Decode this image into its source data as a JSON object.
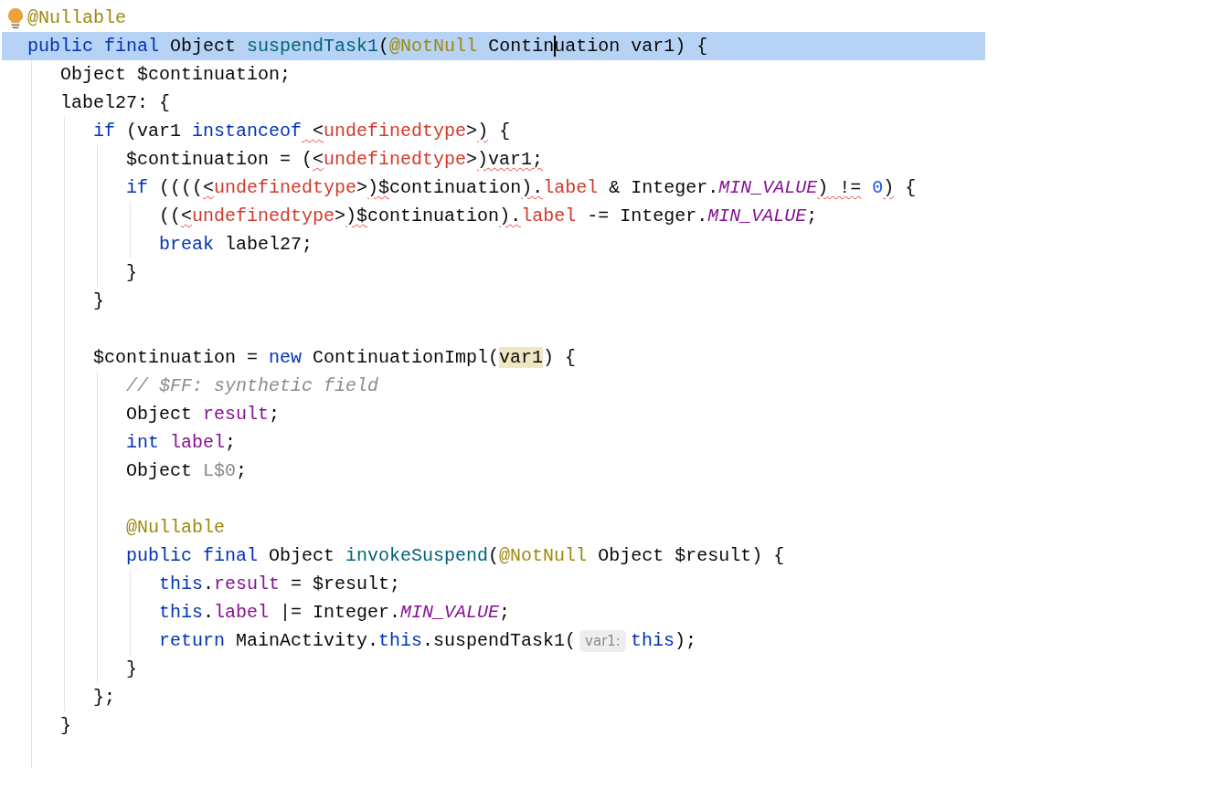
{
  "editor": {
    "lines": [
      {
        "current": false,
        "intention_bulb": true,
        "tokens": [
          {
            "kind": "annotation",
            "text": "@Nullable"
          }
        ]
      },
      {
        "current": true,
        "tokens": [
          {
            "kind": "keyword",
            "text": "public final "
          },
          {
            "kind": "plain",
            "text": "Object "
          },
          {
            "kind": "method",
            "text": "suspendTask1"
          },
          {
            "kind": "plain",
            "text": "("
          },
          {
            "kind": "annotation",
            "text": "@NotNull "
          },
          {
            "kind": "plain",
            "text": "Contin"
          },
          {
            "kind": "plain",
            "text": "uation var1) {",
            "caret": true
          }
        ],
        "children": [
          {
            "current": false,
            "tokens": [
              {
                "kind": "plain",
                "text": "Object $continuation;"
              }
            ]
          },
          {
            "current": false,
            "tokens": [
              {
                "kind": "plain",
                "text": "label27: {"
              }
            ],
            "children": [
              {
                "current": false,
                "tokens": [
                  {
                    "kind": "keyword",
                    "text": "if"
                  },
                  {
                    "kind": "plain",
                    "text": " (var1 "
                  },
                  {
                    "kind": "keyword",
                    "text": "instanceof"
                  },
                  {
                    "kind": "plain",
                    "text": " <",
                    "error": true
                  },
                  {
                    "kind": "unresolved",
                    "text": "undefinedtype"
                  },
                  {
                    "kind": "plain",
                    "text": ">"
                  },
                  {
                    "kind": "plain",
                    "text": ")",
                    "error": true
                  },
                  {
                    "kind": "plain",
                    "text": " {"
                  }
                ],
                "children": [
                  {
                    "current": false,
                    "tokens": [
                      {
                        "kind": "plain",
                        "text": "$continuation = ("
                      },
                      {
                        "kind": "plain",
                        "text": "<",
                        "error": true
                      },
                      {
                        "kind": "unresolved",
                        "text": "undefinedtype"
                      },
                      {
                        "kind": "plain",
                        "text": ">"
                      },
                      {
                        "kind": "plain",
                        "text": ")var1;",
                        "error": true
                      }
                    ]
                  },
                  {
                    "current": false,
                    "tokens": [
                      {
                        "kind": "keyword",
                        "text": "if"
                      },
                      {
                        "kind": "plain",
                        "text": " (((("
                      },
                      {
                        "kind": "plain",
                        "text": "<",
                        "error": true
                      },
                      {
                        "kind": "unresolved",
                        "text": "undefinedtype"
                      },
                      {
                        "kind": "plain",
                        "text": ">"
                      },
                      {
                        "kind": "plain",
                        "text": ")$",
                        "error": true
                      },
                      {
                        "kind": "plain",
                        "text": "continuation"
                      },
                      {
                        "kind": "plain",
                        "text": ").",
                        "error": true
                      },
                      {
                        "kind": "unresolved",
                        "text": "label"
                      },
                      {
                        "kind": "plain",
                        "text": " & Integer."
                      },
                      {
                        "kind": "constant",
                        "text": "MIN_VALUE"
                      },
                      {
                        "kind": "plain",
                        "text": ")",
                        "error": true
                      },
                      {
                        "kind": "plain",
                        "text": " !=",
                        "error": true
                      },
                      {
                        "kind": "number",
                        "text": " 0"
                      },
                      {
                        "kind": "plain",
                        "text": ")",
                        "error": true
                      },
                      {
                        "kind": "plain",
                        "text": " {"
                      }
                    ],
                    "children": [
                      {
                        "current": false,
                        "tokens": [
                          {
                            "kind": "plain",
                            "text": "(("
                          },
                          {
                            "kind": "plain",
                            "text": "<",
                            "error": true
                          },
                          {
                            "kind": "unresolved",
                            "text": "undefinedtype"
                          },
                          {
                            "kind": "plain",
                            "text": ">"
                          },
                          {
                            "kind": "plain",
                            "text": ")$",
                            "error": true
                          },
                          {
                            "kind": "plain",
                            "text": "continuation"
                          },
                          {
                            "kind": "plain",
                            "text": ").",
                            "error": true
                          },
                          {
                            "kind": "unresolved",
                            "text": "label"
                          },
                          {
                            "kind": "plain",
                            "text": " -= Integer."
                          },
                          {
                            "kind": "constant",
                            "text": "MIN_VALUE"
                          },
                          {
                            "kind": "plain",
                            "text": ";"
                          }
                        ]
                      },
                      {
                        "current": false,
                        "tokens": [
                          {
                            "kind": "keyword",
                            "text": "break"
                          },
                          {
                            "kind": "plain",
                            "text": " label27;"
                          }
                        ]
                      }
                    ]
                  },
                  {
                    "current": false,
                    "tokens": [
                      {
                        "kind": "plain",
                        "text": "}"
                      }
                    ]
                  }
                ]
              },
              {
                "current": false,
                "tokens": [
                  {
                    "kind": "plain",
                    "text": "}"
                  }
                ]
              },
              {
                "current": false
              },
              {
                "current": false,
                "tokens": [
                  {
                    "kind": "plain",
                    "text": "$continuation = "
                  },
                  {
                    "kind": "keyword",
                    "text": "new"
                  },
                  {
                    "kind": "plain",
                    "text": " ContinuationImpl("
                  },
                  {
                    "kind": "plain",
                    "text": "var1",
                    "highlighted": true
                  },
                  {
                    "kind": "plain",
                    "text": ") {"
                  }
                ],
                "children": [
                  {
                    "current": false,
                    "tokens": [
                      {
                        "kind": "comment",
                        "text": "// $FF: synthetic field"
                      }
                    ]
                  },
                  {
                    "current": false,
                    "tokens": [
                      {
                        "kind": "plain",
                        "text": "Object "
                      },
                      {
                        "kind": "field",
                        "text": "result"
                      },
                      {
                        "kind": "plain",
                        "text": ";"
                      }
                    ]
                  },
                  {
                    "current": false,
                    "tokens": [
                      {
                        "kind": "keyword",
                        "text": "int "
                      },
                      {
                        "kind": "field",
                        "text": "label"
                      },
                      {
                        "kind": "plain",
                        "text": ";"
                      }
                    ]
                  },
                  {
                    "current": false,
                    "tokens": [
                      {
                        "kind": "plain",
                        "text": "Object "
                      },
                      {
                        "kind": "synthetic",
                        "text": "L$0"
                      },
                      {
                        "kind": "plain",
                        "text": ";"
                      }
                    ]
                  },
                  {
                    "current": false
                  },
                  {
                    "current": false,
                    "tokens": [
                      {
                        "kind": "annotation",
                        "text": "@Nullable"
                      }
                    ]
                  },
                  {
                    "current": false,
                    "tokens": [
                      {
                        "kind": "keyword",
                        "text": "public final "
                      },
                      {
                        "kind": "plain",
                        "text": "Object "
                      },
                      {
                        "kind": "method",
                        "text": "invokeSuspend"
                      },
                      {
                        "kind": "plain",
                        "text": "("
                      },
                      {
                        "kind": "annotation",
                        "text": "@NotNull "
                      },
                      {
                        "kind": "plain",
                        "text": "Object $result) {"
                      }
                    ],
                    "children": [
                      {
                        "current": false,
                        "tokens": [
                          {
                            "kind": "keyword",
                            "text": "this"
                          },
                          {
                            "kind": "plain",
                            "text": "."
                          },
                          {
                            "kind": "field",
                            "text": "result"
                          },
                          {
                            "kind": "plain",
                            "text": " = $result;"
                          }
                        ]
                      },
                      {
                        "current": false,
                        "tokens": [
                          {
                            "kind": "keyword",
                            "text": "this"
                          },
                          {
                            "kind": "plain",
                            "text": "."
                          },
                          {
                            "kind": "field",
                            "text": "label"
                          },
                          {
                            "kind": "plain",
                            "text": " |= Integer."
                          },
                          {
                            "kind": "constant",
                            "text": "MIN_VALUE"
                          },
                          {
                            "kind": "plain",
                            "text": ";"
                          }
                        ]
                      },
                      {
                        "current": false,
                        "tokens": [
                          {
                            "kind": "keyword",
                            "text": "return"
                          },
                          {
                            "kind": "plain",
                            "text": " MainActivity."
                          },
                          {
                            "kind": "keyword",
                            "text": "this"
                          },
                          {
                            "kind": "plain",
                            "text": ".suspendTask1("
                          },
                          {
                            "kind": "hint",
                            "text": "var1:"
                          },
                          {
                            "kind": "keyword",
                            "text": "this"
                          },
                          {
                            "kind": "plain",
                            "text": ");"
                          }
                        ]
                      }
                    ]
                  },
                  {
                    "current": false,
                    "tokens": [
                      {
                        "kind": "plain",
                        "text": "}"
                      }
                    ]
                  }
                ]
              },
              {
                "current": false,
                "tokens": [
                  {
                    "kind": "plain",
                    "text": "};"
                  }
                ]
              }
            ]
          },
          {
            "current": false,
            "tokens": [
              {
                "kind": "plain",
                "text": "}"
              }
            ]
          },
          {
            "current": false
          }
        ]
      }
    ]
  }
}
